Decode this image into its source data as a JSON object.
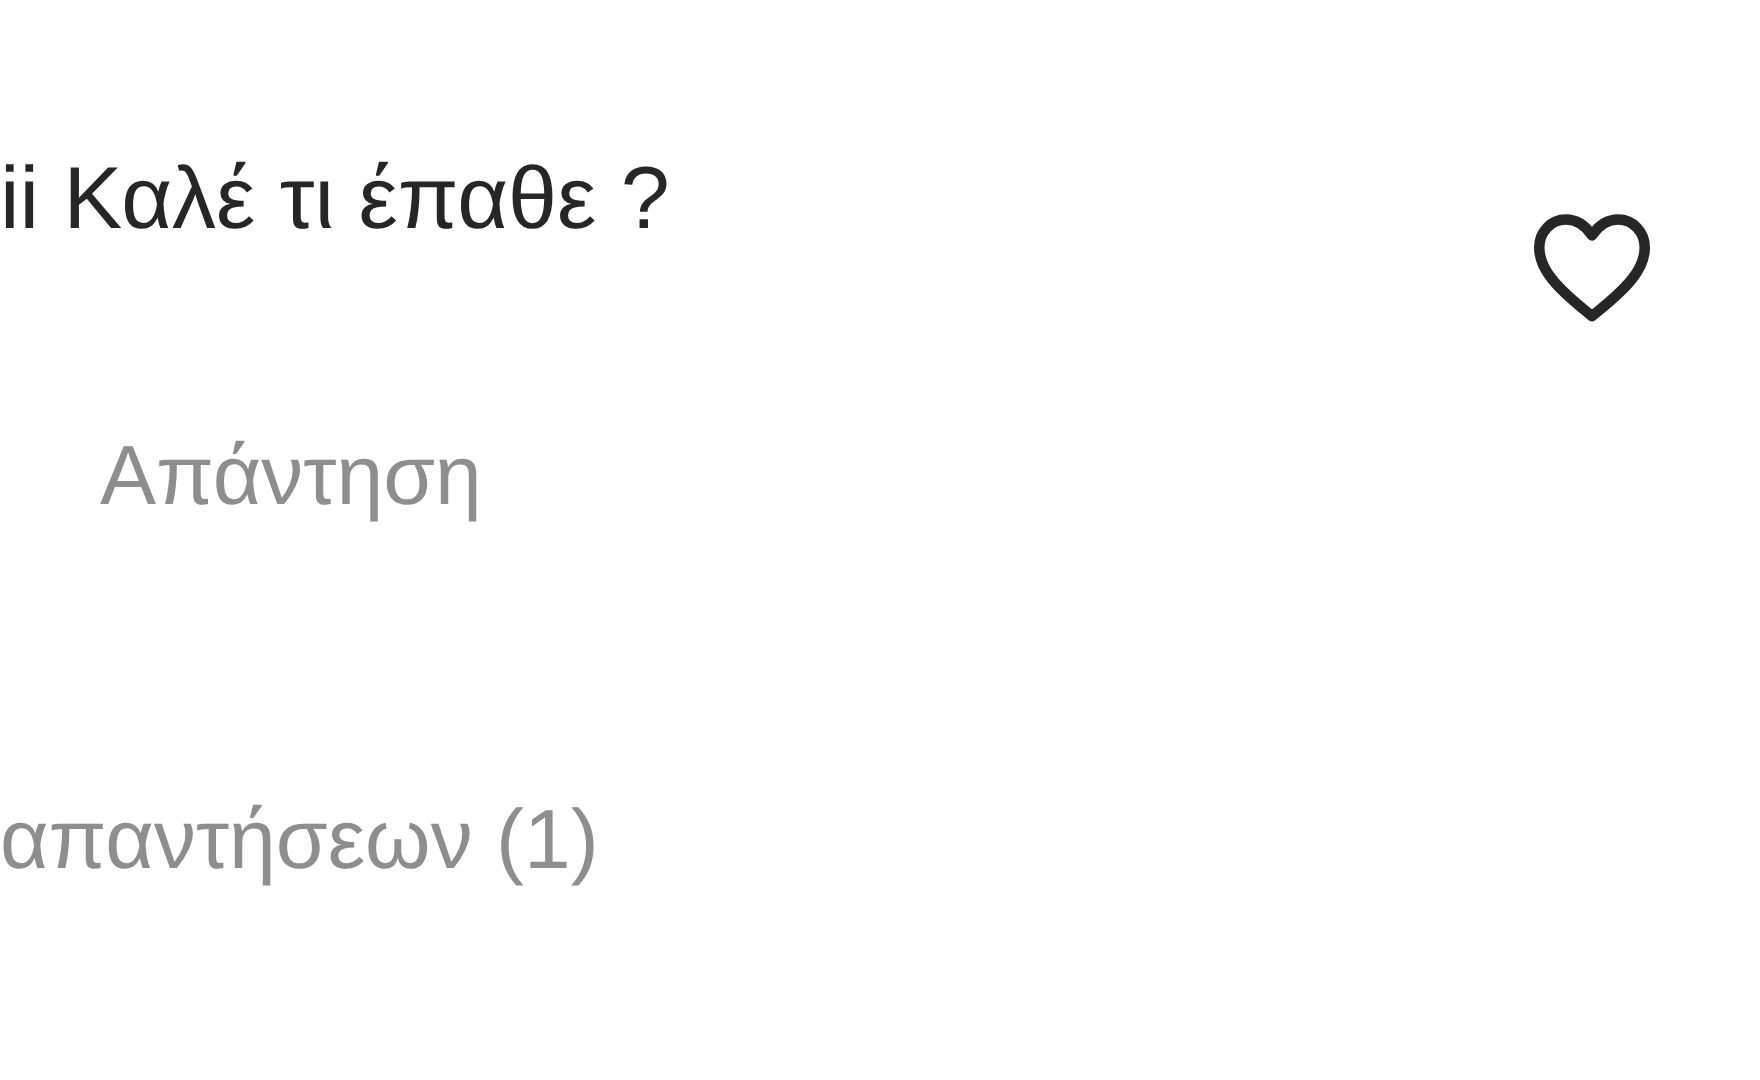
{
  "comment": {
    "text": "ii Καλέ τι έπαθε ?",
    "reply_label": "Απάντηση",
    "liked": false
  },
  "replies_toggle": "απαντήσεων (1)"
}
